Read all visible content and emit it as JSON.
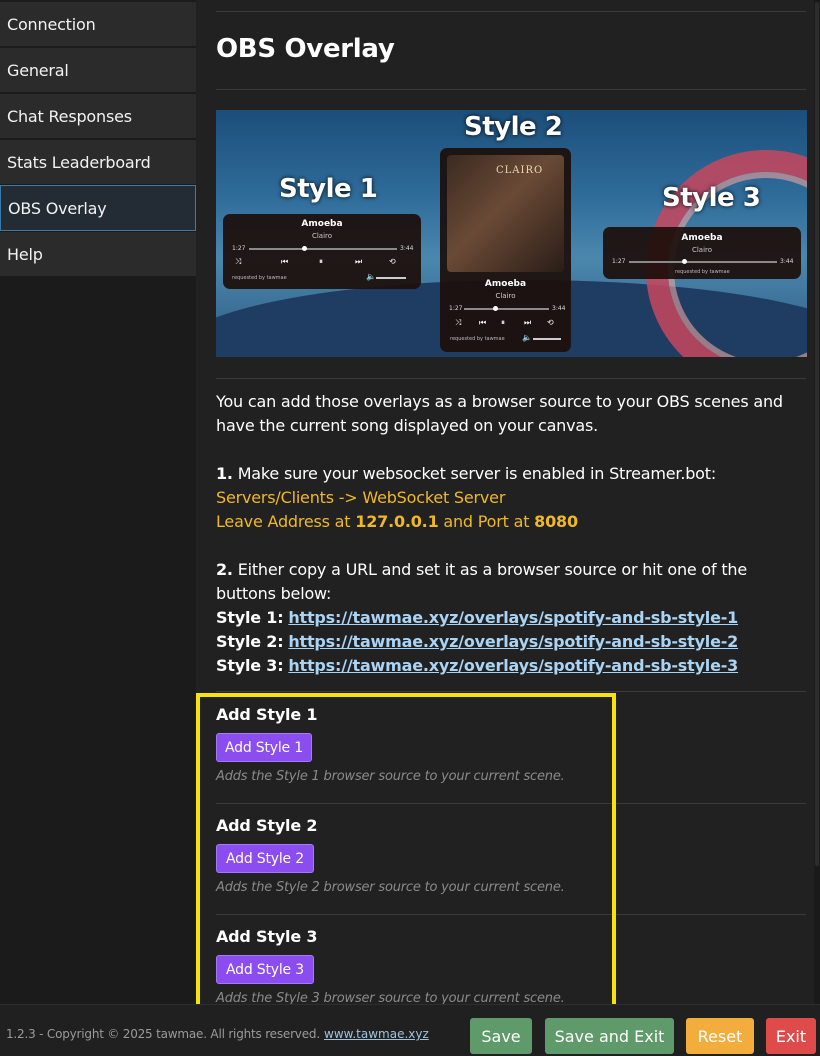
{
  "sidebar": {
    "items": [
      {
        "label": "Connection"
      },
      {
        "label": "General"
      },
      {
        "label": "Chat Responses"
      },
      {
        "label": "Stats Leaderboard"
      },
      {
        "label": "OBS Overlay"
      },
      {
        "label": "Help"
      }
    ],
    "active": "OBS Overlay"
  },
  "main": {
    "title": "OBS Overlay",
    "banner": {
      "style1": "Style 1",
      "style2": "Style 2",
      "style3": "Style 3",
      "song": "Amoeba",
      "artist": "Clairo",
      "cover_title": "CLAIRO",
      "time_start": "1:27",
      "time_end": "3:44",
      "requested_by": "requested by tawmae"
    },
    "intro": "You can add those overlays as a browser source to your OBS scenes and have the current song displayed on your canvas.",
    "step1": {
      "num": "1.",
      "text": "Make sure your websocket server is enabled in Streamer.bot:",
      "line2": "Servers/Clients -> WebSocket Server",
      "leave": "Leave Address at",
      "address": "127.0.0.1",
      "and_port": "and Port at",
      "port": "8080"
    },
    "step2": {
      "num": "2.",
      "text": "Either copy a URL and set it as a browser source or hit one of the buttons below:",
      "urls": [
        {
          "label": "Style 1:",
          "url": "https://tawmae.xyz/overlays/spotify-and-sb-style-1"
        },
        {
          "label": "Style 2:",
          "url": "https://tawmae.xyz/overlays/spotify-and-sb-style-2"
        },
        {
          "label": "Style 3:",
          "url": "https://tawmae.xyz/overlays/spotify-and-sb-style-3"
        }
      ]
    },
    "sections": [
      {
        "title": "Add Style 1",
        "button": "Add Style 1",
        "desc": "Adds the Style 1 browser source to your current scene."
      },
      {
        "title": "Add Style 2",
        "button": "Add Style 2",
        "desc": "Adds the Style 2 browser source to your current scene."
      },
      {
        "title": "Add Style 3",
        "button": "Add Style 3",
        "desc": "Adds the Style 3 browser source to your current scene."
      }
    ]
  },
  "footer": {
    "copyright": "1.2.3 - Copyright © 2025 tawmae. All rights reserved.",
    "site": "www.tawmae.xyz",
    "buttons": {
      "save": "Save",
      "save_exit": "Save and Exit",
      "reset": "Reset",
      "exit": "Exit"
    }
  },
  "colors": {
    "accent_purple": "#8b4cf0",
    "gold": "#f1b826",
    "link": "#a9d4f5",
    "highlight": "#f5e30d",
    "save": "#5f9a6a",
    "reset": "#f2ad3d",
    "exit": "#df4a4a"
  }
}
